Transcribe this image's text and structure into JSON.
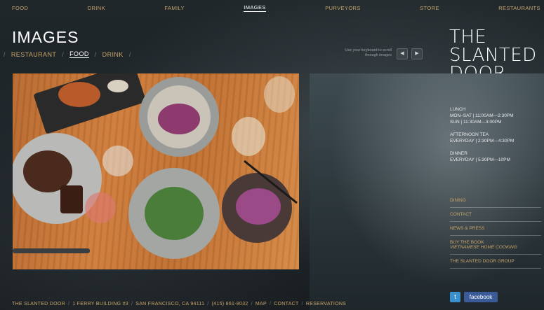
{
  "nav": {
    "items": [
      "FOOD",
      "DRINK",
      "FAMILY",
      "IMAGES",
      "PURVEYORS",
      "STORE",
      "RESTAURANTS"
    ],
    "active": "IMAGES"
  },
  "page": {
    "title": "IMAGES",
    "subnav": [
      "RESTAURANT",
      "FOOD",
      "DRINK"
    ],
    "subnav_active": "FOOD",
    "keyboard_hint": "Use your keyboard to scroll through images",
    "prev_icon": "triangle-left",
    "next_icon": "triangle-right"
  },
  "logo": {
    "lines": [
      "THE",
      "SLANTED",
      "DOOR"
    ]
  },
  "hours": {
    "lunch_title": "LUNCH",
    "lunch_1": "MON–SAT | 11:00AM—2:30PM",
    "lunch_2": "SUN | 11:30AM—3:00PM",
    "tea_title": "AFTERNOON TEA",
    "tea_1": "EVERYDAY | 2:30PM—4:30PM",
    "dinner_title": "DINNER",
    "dinner_1": "EVERYDAY | 5:30PM—10PM"
  },
  "side_links": {
    "dining": "DINING",
    "contact": "CONTACT",
    "news": "NEWS & PRESS",
    "book_1": "BUY THE BOOK",
    "book_2": "VIETNAMESE HOME COOKING",
    "group": "THE SLANTED DOOR GROUP"
  },
  "social": {
    "twitter_icon": "twitter-bird",
    "facebook_label": "facebook"
  },
  "footer": {
    "name": "THE SLANTED DOOR",
    "address": "1 FERRY BUILDING #3",
    "city": "SAN FRANCISCO, CA 94111",
    "phone": "(415) 861-8032",
    "map": "MAP",
    "contact": "CONTACT",
    "reservations": "RESERVATIONS"
  },
  "colors": {
    "accent": "#c8a56a",
    "active": "#ffffff",
    "background": "#1b2125"
  }
}
